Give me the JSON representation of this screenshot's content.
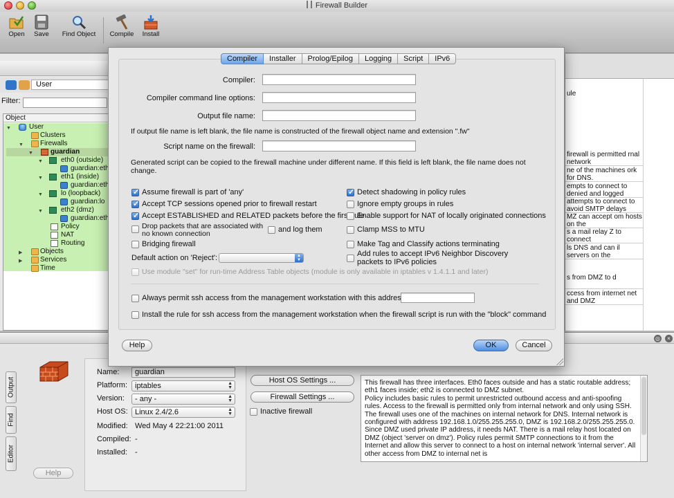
{
  "window": {
    "title": "Firewall Builder"
  },
  "toolbar": {
    "buttons": [
      {
        "label": "Open",
        "icon": "open-icon"
      },
      {
        "label": "Save",
        "icon": "save-icon"
      },
      {
        "label": "Find Object",
        "icon": "find-icon"
      },
      {
        "label": "Compile",
        "icon": "compile-icon"
      },
      {
        "label": "Install",
        "icon": "install-icon"
      }
    ]
  },
  "left_panel": {
    "library": "User",
    "filter_label": "Filter:",
    "tree_header": "Object",
    "tree": [
      {
        "label": "User",
        "icon": "library-icon"
      },
      {
        "label": "Clusters",
        "icon": "folder-icon"
      },
      {
        "label": "Firewalls",
        "icon": "folder-icon"
      },
      {
        "label": "guardian",
        "icon": "firewall-icon"
      },
      {
        "label": "eth0 (outside)",
        "icon": "interface-icon"
      },
      {
        "label": "guardian:eth",
        "icon": "address-icon"
      },
      {
        "label": "eth1 (inside)",
        "icon": "interface-icon"
      },
      {
        "label": "guardian:eth",
        "icon": "address-icon"
      },
      {
        "label": "lo (loopback)",
        "icon": "interface-icon"
      },
      {
        "label": "guardian:lo",
        "icon": "address-icon"
      },
      {
        "label": "eth2 (dmz)",
        "icon": "interface-icon"
      },
      {
        "label": "guardian:eth",
        "icon": "address-icon"
      },
      {
        "label": "Policy",
        "icon": "policy-icon"
      },
      {
        "label": "NAT",
        "icon": "policy-icon"
      },
      {
        "label": "Routing",
        "icon": "policy-icon"
      },
      {
        "label": "Objects",
        "icon": "folder-icon"
      },
      {
        "label": "Services",
        "icon": "folder-icon"
      },
      {
        "label": "Time",
        "icon": "folder-icon"
      }
    ]
  },
  "right_panel": {
    "header_fragment": "ule",
    "rules": [
      "firewall is permitted\nrnal network",
      "ne of the machines\nork for DNS.",
      "empts to connect to\ndenied and logged",
      "attempts to connect\nto avoid SMTP delays",
      "MZ can accept\nom hosts on the",
      "s a mail relay\nZ to connect",
      "ls DNS and can\nil servers on the",
      "s from DMZ to\nd",
      "ccess from internet net\nand DMZ"
    ]
  },
  "dialog": {
    "tabs": [
      "Compiler",
      "Installer",
      "Prolog/Epilog",
      "Logging",
      "Script",
      "IPv6"
    ],
    "active_tab": "Compiler",
    "fields": {
      "compiler": {
        "label": "Compiler:",
        "value": ""
      },
      "cmdline": {
        "label": "Compiler command line options:",
        "value": ""
      },
      "output": {
        "label": "Output file name:",
        "value": ""
      },
      "script_name": {
        "label": "Script name on the firewall:",
        "value": ""
      }
    },
    "note_output": "If output file name is left blank, the file name is constructed of the firewall object name and extension \".fw\"",
    "note_script": "Generated script can be copied to the firewall machine under different name. If this field is left blank, the file name does not change.",
    "options": {
      "assume_any": {
        "label": "Assume firewall is part of 'any'",
        "checked": true
      },
      "accept_tcp": {
        "label": "Accept TCP sessions opened prior to firewall restart",
        "checked": true
      },
      "accept_established": {
        "label": "Accept ESTABLISHED and RELATED packets before the first rule",
        "checked": true
      },
      "drop_packets": {
        "label": "Drop packets that are associated with no known connection",
        "checked": false
      },
      "log_them": {
        "label": "and log them",
        "checked": false
      },
      "bridging": {
        "label": "Bridging firewall",
        "checked": false
      },
      "detect_shadowing": {
        "label": "Detect shadowing in policy rules",
        "checked": true
      },
      "ignore_empty": {
        "label": "Ignore empty groups in rules",
        "checked": false
      },
      "nat_local": {
        "label": "Enable support for NAT of locally originated connections",
        "checked": false
      },
      "clamp_mss": {
        "label": "Clamp MSS to MTU",
        "checked": false
      },
      "make_tag": {
        "label": "Make Tag and Classify actions terminating",
        "checked": false
      },
      "ipv6_nd": {
        "label": "Add rules to accept IPv6 Neighbor Discovery packets to IPv6 policies",
        "checked": false
      },
      "module_set": {
        "label": "Use module \"set\" for run-time Address Table objects (module is only available in iptables v 1.4.1.1 and later)",
        "checked": false
      },
      "ssh_permit": {
        "label": "Always permit ssh access from the management workstation with this address:",
        "checked": false
      },
      "ssh_block": {
        "label": "Install the rule for ssh access from the management workstation when the firewall script is run with the \"block\" command",
        "checked": false
      }
    },
    "reject_label": "Default action on 'Reject':",
    "reject_value": "",
    "ssh_address": "",
    "buttons": {
      "help": "Help",
      "ok": "OK",
      "cancel": "Cancel"
    }
  },
  "editor": {
    "side_tabs": [
      "Output",
      "Find",
      "Editor"
    ],
    "name_label": "Name:",
    "name_value": "guardian",
    "platform_label": "Platform:",
    "platform_value": "iptables",
    "version_label": "Version:",
    "version_value": "- any -",
    "hostos_label": "Host OS:",
    "hostos_value": "Linux 2.4/2.6",
    "modified_label": "Modified:",
    "modified_value": "Wed May  4 22:21:00 2011",
    "compiled_label": "Compiled:",
    "compiled_value": "-",
    "installed_label": "Installed:",
    "installed_value": "-",
    "host_os_settings": "Host OS Settings ...",
    "firewall_settings": "Firewall Settings ...",
    "inactive_label": "Inactive firewall",
    "help_label": "Help",
    "comment": "This firewall has three interfaces. Eth0 faces outside and has a static routable address; eth1 faces inside; eth2 is connected to DMZ subnet.\nPolicy includes basic rules to permit unrestricted outbound access and anti-spoofing rules. Access to the firewall is permitted only from internal network and only using SSH. The firewall uses one of the machines on internal network for DNS. Internal network is configured with address 192.168.1.0/255.255.255.0, DMZ is 192.168.2.0/255.255.255.0. Since DMZ used private IP address, it needs NAT. There is a mail relay host located on DMZ (object 'server on dmz'). Policy rules permit SMTP connections to it from the Internet and allow this server to connect to a host on internal network 'internal server'. All other access from DMZ to internal net is"
  }
}
